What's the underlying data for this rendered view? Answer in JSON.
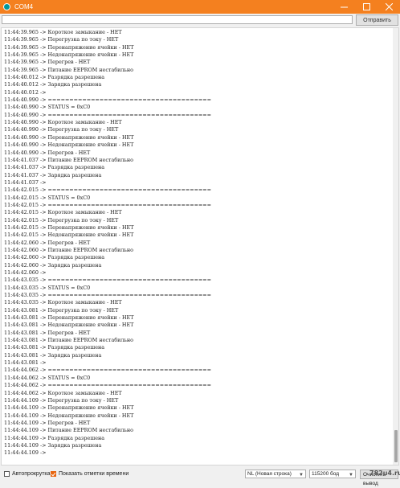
{
  "window": {
    "title": "COM4"
  },
  "command": {
    "input_value": "",
    "send_label": "Отправить"
  },
  "lines": [
    {
      "time": "11:44:39.965",
      "text": "-> Короткое замыкание - НЕТ"
    },
    {
      "time": "11:44:39.965",
      "text": "-> Перегрузка по току - НЕТ"
    },
    {
      "time": "11:44:39.965",
      "text": "-> Перенапряжение ячейки - НЕТ"
    },
    {
      "time": "11:44:39.965",
      "text": "-> Недонапряжение ячейки - НЕТ"
    },
    {
      "time": "11:44:39.965",
      "text": "-> Перегрев - НЕТ"
    },
    {
      "time": "11:44:39.965",
      "text": "-> Питание EEPROM нестабильно"
    },
    {
      "time": "11:44:40.012",
      "text": "-> Разрядка разрешена"
    },
    {
      "time": "11:44:40.012",
      "text": "-> Зарядка разрешена"
    },
    {
      "time": "11:44:40.012",
      "text": "->"
    },
    {
      "time": "11:44:40.990",
      "text": "-> ======================================"
    },
    {
      "time": "11:44:40.990",
      "text": "-> STATUS = 0xC0"
    },
    {
      "time": "11:44:40.990",
      "text": "-> ======================================"
    },
    {
      "time": "11:44:40.990",
      "text": "-> Короткое замыкание - НЕТ"
    },
    {
      "time": "11:44:40.990",
      "text": "-> Перегрузка по току - НЕТ"
    },
    {
      "time": "11:44:40.990",
      "text": "-> Перенапряжение ячейки - НЕТ"
    },
    {
      "time": "11:44:40.990",
      "text": "-> Недонапряжение ячейки - НЕТ"
    },
    {
      "time": "11:44:40.990",
      "text": "-> Перегрев - НЕТ"
    },
    {
      "time": "11:44:41.037",
      "text": "-> Питание EEPROM нестабильно"
    },
    {
      "time": "11:44:41.037",
      "text": "-> Разрядка разрешена"
    },
    {
      "time": "11:44:41.037",
      "text": "-> Зарядка разрешена"
    },
    {
      "time": "11:44:41.037",
      "text": "->"
    },
    {
      "time": "11:44:42.015",
      "text": "-> ======================================"
    },
    {
      "time": "11:44:42.015",
      "text": "-> STATUS = 0xC0"
    },
    {
      "time": "11:44:42.015",
      "text": "-> ======================================"
    },
    {
      "time": "11:44:42.015",
      "text": "-> Короткое замыкание - НЕТ"
    },
    {
      "time": "11:44:42.015",
      "text": "-> Перегрузка по току - НЕТ"
    },
    {
      "time": "11:44:42.015",
      "text": "-> Перенапряжение ячейки - НЕТ"
    },
    {
      "time": "11:44:42.015",
      "text": "-> Недонапряжение ячейки - НЕТ"
    },
    {
      "time": "11:44:42.060",
      "text": "-> Перегрев - НЕТ"
    },
    {
      "time": "11:44:42.060",
      "text": "-> Питание EEPROM нестабильно"
    },
    {
      "time": "11:44:42.060",
      "text": "-> Разрядка разрешена"
    },
    {
      "time": "11:44:42.060",
      "text": "-> Зарядка разрешена"
    },
    {
      "time": "11:44:42.060",
      "text": "->"
    },
    {
      "time": "11:44:43.035",
      "text": "-> ======================================"
    },
    {
      "time": "11:44:43.035",
      "text": "-> STATUS = 0xC0"
    },
    {
      "time": "11:44:43.035",
      "text": "-> ======================================"
    },
    {
      "time": "11:44:43.035",
      "text": "-> Короткое замыкание - НЕТ"
    },
    {
      "time": "11:44:43.081",
      "text": "-> Перегрузка по току - НЕТ"
    },
    {
      "time": "11:44:43.081",
      "text": "-> Перенапряжение ячейки - НЕТ"
    },
    {
      "time": "11:44:43.081",
      "text": "-> Недонапряжение ячейки - НЕТ"
    },
    {
      "time": "11:44:43.081",
      "text": "-> Перегрев - НЕТ"
    },
    {
      "time": "11:44:43.081",
      "text": "-> Питание EEPROM нестабильно"
    },
    {
      "time": "11:44:43.081",
      "text": "-> Разрядка разрешена"
    },
    {
      "time": "11:44:43.081",
      "text": "-> Зарядка разрешена"
    },
    {
      "time": "11:44:43.081",
      "text": "->"
    },
    {
      "time": "11:44:44.062",
      "text": "-> ======================================"
    },
    {
      "time": "11:44:44.062",
      "text": "-> STATUS = 0xC0"
    },
    {
      "time": "11:44:44.062",
      "text": "-> ======================================"
    },
    {
      "time": "11:44:44.062",
      "text": "-> Короткое замыкание - НЕТ"
    },
    {
      "time": "11:44:44.109",
      "text": "-> Перегрузка по току - НЕТ"
    },
    {
      "time": "11:44:44.109",
      "text": "-> Перенапряжение ячейки - НЕТ"
    },
    {
      "time": "11:44:44.109",
      "text": "-> Недонапряжение ячейки - НЕТ"
    },
    {
      "time": "11:44:44.109",
      "text": "-> Перегрев - НЕТ"
    },
    {
      "time": "11:44:44.109",
      "text": "-> Питание EEPROM нестабильно"
    },
    {
      "time": "11:44:44.109",
      "text": "-> Разрядка разрешена"
    },
    {
      "time": "11:44:44.109",
      "text": "-> Зарядка разрешена"
    },
    {
      "time": "11:44:44.109",
      "text": "->"
    }
  ],
  "footer": {
    "autoscroll_label": "Автопрокрутка",
    "autoscroll_checked": false,
    "timestamps_label": "Показать отметки времени",
    "timestamps_checked": true,
    "line_ending_value": "NL (Новая строка)",
    "baud_value": "115200 бод",
    "clear_label": "Очистить вывод"
  },
  "colors": {
    "title_bar": "#f4801f",
    "accent": "#e8650f"
  },
  "watermark": "782u4.ru"
}
